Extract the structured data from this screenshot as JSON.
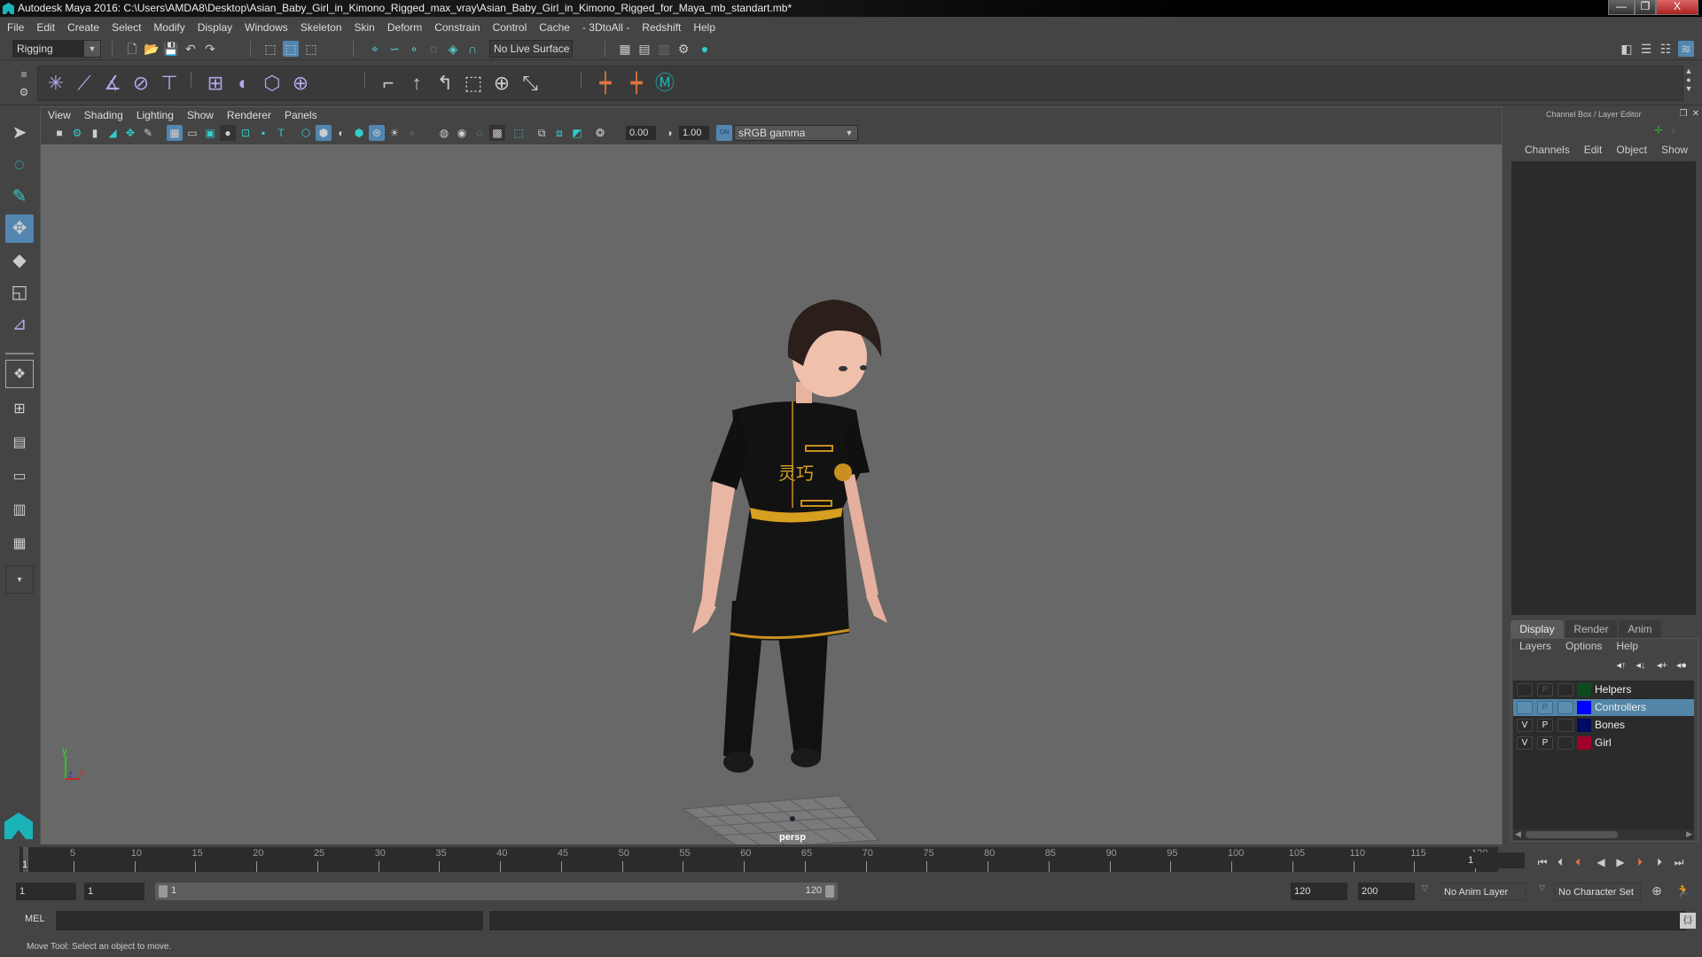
{
  "window": {
    "title": "Autodesk Maya 2016: C:\\Users\\AMDA8\\Desktop\\Asian_Baby_Girl_in_Kimono_Rigged_max_vray\\Asian_Baby_Girl_in_Kimono_Rigged_for_Maya_mb_standart.mb*",
    "minimize": "—",
    "restore": "❐",
    "close": "X"
  },
  "menubar": [
    "File",
    "Edit",
    "Create",
    "Select",
    "Modify",
    "Display",
    "Windows",
    "Skeleton",
    "Skin",
    "Deform",
    "Constrain",
    "Control",
    "Cache",
    "- 3DtoAll -",
    "Redshift",
    "Help"
  ],
  "status_line": {
    "menu_set": "Rigging",
    "live_surface": "No Live Surface"
  },
  "viewport": {
    "menus": [
      "View",
      "Shading",
      "Lighting",
      "Show",
      "Renderer",
      "Panels"
    ],
    "exposure": "0.00",
    "gamma": "1.00",
    "color_mgmt_badge": "ON",
    "color_space": "sRGB gamma",
    "camera_label": "persp",
    "axis": {
      "y": "y",
      "z": "z",
      "x": "x"
    },
    "shirt_text": "灵巧"
  },
  "channel_box": {
    "title": "Channel Box / Layer Editor",
    "menus": [
      "Channels",
      "Edit",
      "Object",
      "Show"
    ],
    "tabs": [
      "Display",
      "Render",
      "Anim"
    ],
    "active_tab": "Display",
    "layer_menus": [
      "Layers",
      "Options",
      "Help"
    ],
    "layers": [
      {
        "name": "Helpers",
        "v": "",
        "p": "P",
        "color": "#0f4a1f",
        "selected": false
      },
      {
        "name": "Controllers",
        "v": "",
        "p": "P",
        "color": "#0000ff",
        "selected": true
      },
      {
        "name": "Bones",
        "v": "V",
        "p": "P",
        "color": "#000c62",
        "selected": false
      },
      {
        "name": "Girl",
        "v": "V",
        "p": "P",
        "color": "#a0002a",
        "selected": false
      }
    ]
  },
  "time_slider": {
    "start_marker": "1",
    "ticks": [
      "5",
      "10",
      "15",
      "20",
      "25",
      "30",
      "35",
      "40",
      "45",
      "50",
      "55",
      "60",
      "65",
      "70",
      "75",
      "80",
      "85",
      "90",
      "95",
      "100",
      "105",
      "110",
      "115",
      "120"
    ],
    "current_frame": "1"
  },
  "range_slider": {
    "start_time": "1",
    "playback_start": "1",
    "range_start_label": "1",
    "range_end_label": "120",
    "playback_end": "120",
    "end_time": "200",
    "anim_layer": "No Anim Layer",
    "character_set": "No Character Set"
  },
  "command_line": {
    "language": "MEL",
    "input": "",
    "result": ""
  },
  "help_line": "Move Tool: Select an object to move.",
  "colors": {
    "accent": "#5286b0",
    "maya_teal": "#1ab3b8",
    "rig_orange": "#e0743c",
    "shelf_purple": "#b4a6ea"
  }
}
